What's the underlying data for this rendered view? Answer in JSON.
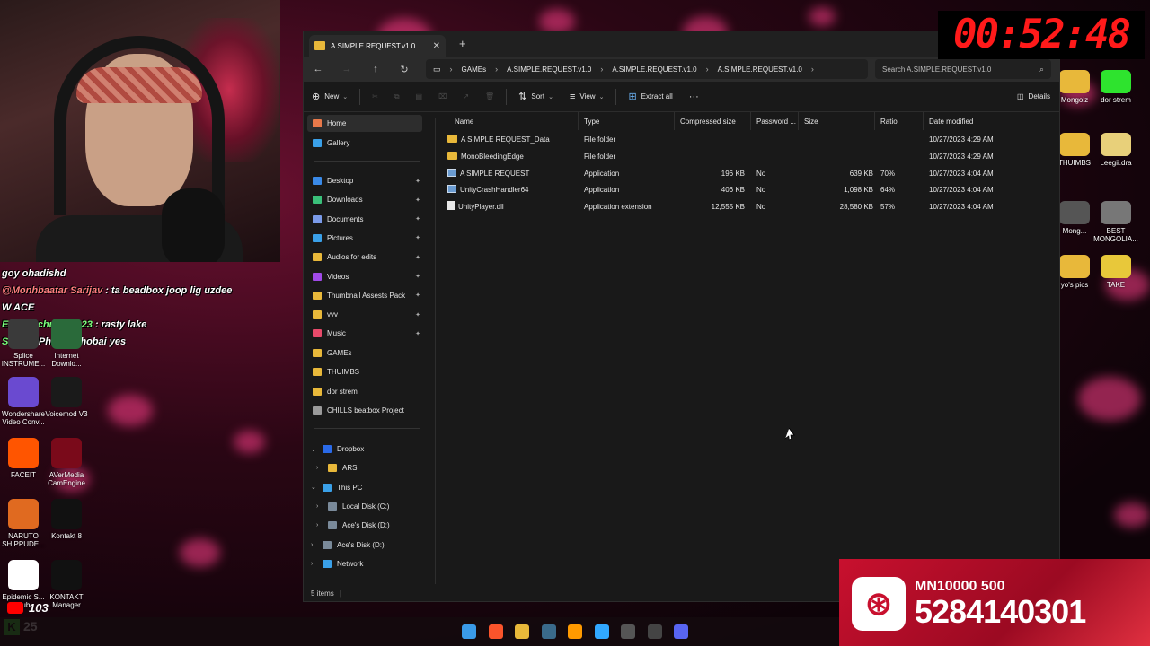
{
  "overlay": {
    "timer": "00:52:48",
    "chat": [
      {
        "user": "",
        "text": "goy ohadishd"
      },
      {
        "user": "@Monhbaatar Sarijav",
        "text": ": ta beadbox joop lig uzdee"
      },
      {
        "user": "",
        "text": "W ACE"
      },
      {
        "user": "Endenechuluun123",
        "text": ": rasty lake"
      },
      {
        "user": "Sklize",
        "text": ": Phasnophobai yes"
      }
    ],
    "youtube_count": "103",
    "kick_count": "25",
    "bank": {
      "line1": "MN10000 500",
      "line2": "5284140301"
    }
  },
  "desktop_icons_left": [
    {
      "label": "Splice INSTRUME...",
      "color": "#3a3a3a"
    },
    {
      "label": "Internet Downlo...",
      "color": "#2a6a3a"
    },
    {
      "label": "Wondershare Video Conv...",
      "color": "#6a4ad0"
    },
    {
      "label": "Voicemod V3",
      "color": "#1a1a1a"
    },
    {
      "label": "FACEIT",
      "color": "#ff5500"
    },
    {
      "label": "AVerMedia CamEngine",
      "color": "#7a0a1a"
    },
    {
      "label": "NARUTO SHIPPUDE...",
      "color": "#e06a20"
    },
    {
      "label": "Kontakt 8",
      "color": "#111111"
    },
    {
      "label": "Epidemic S... Hub",
      "color": "#ffffff"
    },
    {
      "label": "KONTAKT Manager",
      "color": "#111111"
    }
  ],
  "desktop_icons_right": [
    {
      "label": "Mongolz",
      "color": "#e8b83a"
    },
    {
      "label": "dor strem",
      "color": "#2ee32e"
    },
    {
      "label": "THUIMBS",
      "color": "#e8b83a"
    },
    {
      "label": "Leegii.dra",
      "color": "#e8d07a"
    },
    {
      "label": "Mong...",
      "color": "#555555"
    },
    {
      "label": "BEST MONGOLIA...",
      "color": "#777777"
    },
    {
      "label": "yo's pics",
      "color": "#e8b83a"
    },
    {
      "label": "TAKE",
      "color": "#e8c83a"
    }
  ],
  "explorer": {
    "tab_title": "A.SIMPLE.REQUEST.v1.0",
    "breadcrumb": [
      "GAMEs",
      "A.SIMPLE.REQUEST.v1.0",
      "A.SIMPLE.REQUEST.v1.0",
      "A.SIMPLE.REQUEST.v1.0"
    ],
    "search_placeholder": "Search A.SIMPLE.REQUEST.v1.0",
    "toolbar": {
      "new": "New",
      "sort": "Sort",
      "view": "View",
      "extract_all": "Extract all",
      "more": "···",
      "details": "Details"
    },
    "nav": {
      "quick": [
        {
          "label": "Home",
          "color": "#e8794a",
          "selected": true
        },
        {
          "label": "Gallery",
          "color": "#3aa0e8"
        }
      ],
      "pinned": [
        {
          "label": "Desktop",
          "color": "#3a8ae8"
        },
        {
          "label": "Downloads",
          "color": "#3ac07a"
        },
        {
          "label": "Documents",
          "color": "#7a9ae8"
        },
        {
          "label": "Pictures",
          "color": "#3aa0e8"
        },
        {
          "label": "Audios for edits",
          "color": "#e8b83a"
        },
        {
          "label": "Videos",
          "color": "#a04ae8"
        },
        {
          "label": "Thumbnail Assests Pack",
          "color": "#e8b83a"
        },
        {
          "label": "vvv",
          "color": "#e8b83a"
        },
        {
          "label": "Music",
          "color": "#e84a6a"
        }
      ],
      "recent": [
        {
          "label": "GAMEs",
          "color": "#e8b83a"
        },
        {
          "label": "THUIMBS",
          "color": "#e8b83a"
        },
        {
          "label": "dor strem",
          "color": "#e8b83a"
        },
        {
          "label": "CHILLS beatbox Project",
          "color": "#9a9a9a"
        }
      ],
      "tree": [
        {
          "label": "Dropbox",
          "chev": "⌄",
          "indent": 0,
          "color": "#2a6ae8"
        },
        {
          "label": "ARS",
          "chev": "›",
          "indent": 1,
          "color": "#e8b83a"
        },
        {
          "label": "This PC",
          "chev": "⌄",
          "indent": 0,
          "color": "#3aa0e8"
        },
        {
          "label": "Local Disk (C:)",
          "chev": "›",
          "indent": 1,
          "color": "#7a8a9a"
        },
        {
          "label": "Ace's Disk (D:)",
          "chev": "›",
          "indent": 1,
          "color": "#7a8a9a"
        },
        {
          "label": "Ace's Disk (D:)",
          "chev": "›",
          "indent": 0,
          "color": "#7a8a9a"
        },
        {
          "label": "Network",
          "chev": "›",
          "indent": 0,
          "color": "#3aa0e8"
        }
      ]
    },
    "columns": [
      "Name",
      "Type",
      "Compressed size",
      "Password ...",
      "Size",
      "Ratio",
      "Date modified"
    ],
    "files": [
      {
        "name": "A SIMPLE REQUEST_Data",
        "kind": "folder",
        "type": "File folder",
        "compressed": "",
        "password": "",
        "size": "",
        "ratio": "",
        "date": "10/27/2023 4:29 AM"
      },
      {
        "name": "MonoBleedingEdge",
        "kind": "folder",
        "type": "File folder",
        "compressed": "",
        "password": "",
        "size": "",
        "ratio": "",
        "date": "10/27/2023 4:29 AM"
      },
      {
        "name": "A SIMPLE REQUEST",
        "kind": "app",
        "type": "Application",
        "compressed": "196 KB",
        "password": "No",
        "size": "639 KB",
        "ratio": "70%",
        "date": "10/27/2023 4:04 AM"
      },
      {
        "name": "UnityCrashHandler64",
        "kind": "app",
        "type": "Application",
        "compressed": "406 KB",
        "password": "No",
        "size": "1,098 KB",
        "ratio": "64%",
        "date": "10/27/2023 4:04 AM"
      },
      {
        "name": "UnityPlayer.dll",
        "kind": "dll",
        "type": "Application extension",
        "compressed": "12,555 KB",
        "password": "No",
        "size": "28,580 KB",
        "ratio": "57%",
        "date": "10/27/2023 4:04 AM"
      }
    ],
    "status": "5 items"
  },
  "taskbar": [
    {
      "name": "windows-start-icon",
      "color": "#3a9ae8"
    },
    {
      "name": "brave-icon",
      "color": "#fb542b"
    },
    {
      "name": "file-explorer-icon",
      "color": "#e8b83a"
    },
    {
      "name": "davinci-icon",
      "color": "#3a6a8a"
    },
    {
      "name": "illustrator-icon",
      "color": "#ff9a00"
    },
    {
      "name": "photoshop-icon",
      "color": "#31a8ff"
    },
    {
      "name": "live-icon",
      "color": "#555555"
    },
    {
      "name": "obs-icon",
      "color": "#444444"
    },
    {
      "name": "discord-icon",
      "color": "#5865f2"
    }
  ]
}
